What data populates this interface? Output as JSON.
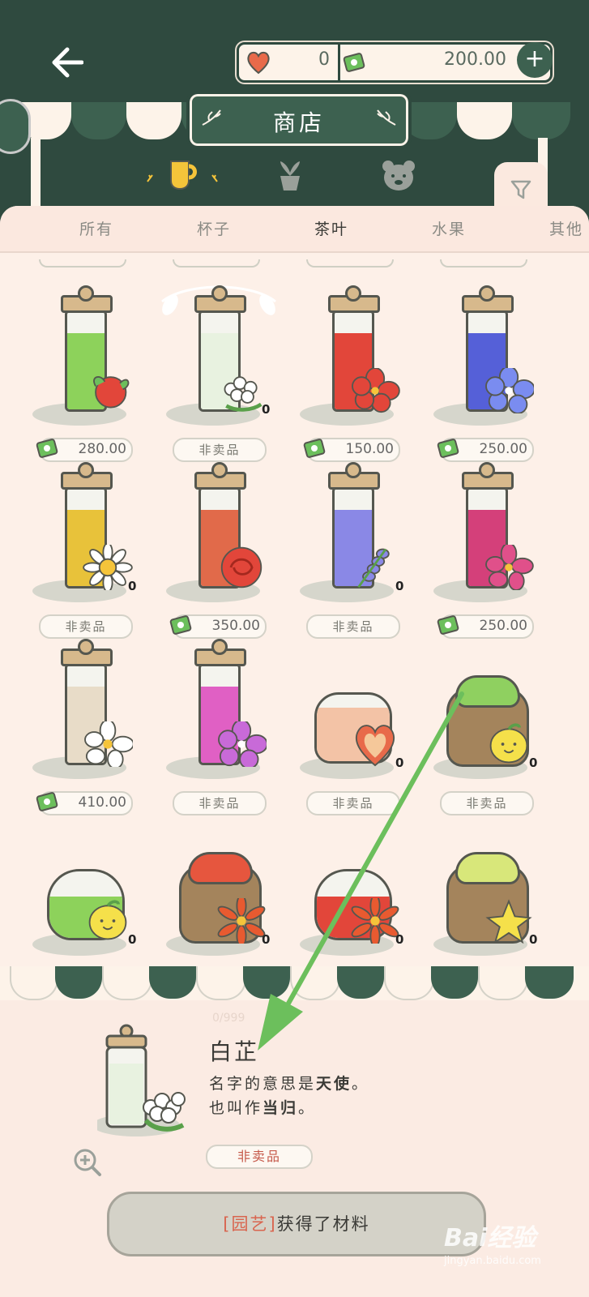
{
  "header": {
    "title": "商店",
    "hearts": "0",
    "cash": "200.00",
    "plus_label": "+"
  },
  "tabs": [
    {
      "label": "所有",
      "active": false
    },
    {
      "label": "杯子",
      "active": false
    },
    {
      "label": "茶叶",
      "active": true
    },
    {
      "label": "水果",
      "active": false
    },
    {
      "label": "其他",
      "active": false
    }
  ],
  "items": [
    {
      "row": 0,
      "col": 0,
      "type": "jar",
      "fill": "#8dd25b",
      "flower": "apple",
      "price": "280.00",
      "for_sale": true,
      "qty": ""
    },
    {
      "row": 0,
      "col": 1,
      "type": "jar",
      "fill": "#e8f2e0",
      "flower": "white-cluster",
      "price": "",
      "for_sale": false,
      "qty": "0"
    },
    {
      "row": 0,
      "col": 2,
      "type": "jar",
      "fill": "#e2463a",
      "flower": "red-hibiscus",
      "price": "150.00",
      "for_sale": true,
      "qty": ""
    },
    {
      "row": 0,
      "col": 3,
      "type": "jar",
      "fill": "#5560d8",
      "flower": "blue-flower",
      "price": "250.00",
      "for_sale": true,
      "qty": ""
    },
    {
      "row": 1,
      "col": 0,
      "type": "jar",
      "fill": "#e8c23a",
      "flower": "daisy",
      "price": "",
      "for_sale": false,
      "qty": "0"
    },
    {
      "row": 1,
      "col": 1,
      "type": "jar",
      "fill": "#e16a4a",
      "flower": "red-rose",
      "price": "350.00",
      "for_sale": true,
      "qty": ""
    },
    {
      "row": 1,
      "col": 2,
      "type": "jar",
      "fill": "#8a88e6",
      "flower": "lavender",
      "price": "",
      "for_sale": false,
      "qty": "0"
    },
    {
      "row": 1,
      "col": 3,
      "type": "jar",
      "fill": "#d4407a",
      "flower": "pink-flower",
      "price": "250.00",
      "for_sale": true,
      "qty": ""
    },
    {
      "row": 2,
      "col": 0,
      "type": "jar",
      "fill": "#e8dcc8",
      "flower": "white-plumeria",
      "price": "410.00",
      "for_sale": true,
      "qty": ""
    },
    {
      "row": 2,
      "col": 1,
      "type": "jar",
      "fill": "#e060c4",
      "flower": "purple-azalea",
      "price": "",
      "for_sale": false,
      "qty": ""
    },
    {
      "row": 2,
      "col": 2,
      "type": "gift",
      "fill": "#f3c3a6",
      "flower": "heart",
      "price": "",
      "for_sale": false,
      "qty": "0"
    },
    {
      "row": 2,
      "col": 3,
      "type": "sack",
      "fill": "#8fd060",
      "flower": "lemon",
      "price": "",
      "for_sale": false,
      "qty": "0"
    },
    {
      "row": 3,
      "col": 0,
      "type": "bowl",
      "fill": "#8dd25b",
      "flower": "lemon",
      "price": "",
      "for_sale": false,
      "qty": "0"
    },
    {
      "row": 3,
      "col": 1,
      "type": "sack",
      "fill": "#e6563e",
      "flower": "orange-flower",
      "price": "",
      "for_sale": false,
      "qty": "0"
    },
    {
      "row": 3,
      "col": 2,
      "type": "bowl",
      "fill": "#e2463a",
      "flower": "orange-flower",
      "price": "",
      "for_sale": false,
      "qty": "0"
    },
    {
      "row": 3,
      "col": 3,
      "type": "sack",
      "fill": "#d8e77a",
      "flower": "star-fruit",
      "price": "",
      "for_sale": false,
      "qty": "0"
    }
  ],
  "not_for_sale_label": "非卖品",
  "detail": {
    "count": "0/999",
    "name": "白芷",
    "desc_line1_a": "名字的意思是",
    "desc_line1_b": "天使",
    "desc_line1_c": "。",
    "desc_line2_a": "也叫作",
    "desc_line2_b": "当归",
    "desc_line2_c": "。",
    "status": "非卖品",
    "action_tag": "[园艺]",
    "action_text": "获得了材料"
  },
  "watermark": {
    "big": "Bai经验",
    "small": "jingyan.baidu.com"
  },
  "colors": {
    "dark_green": "#2f4a3f",
    "accent_green": "#3d6150",
    "cream": "#fdf3e9",
    "arrow": "#6cbf5c",
    "cup_yellow": "#f5c43a"
  }
}
